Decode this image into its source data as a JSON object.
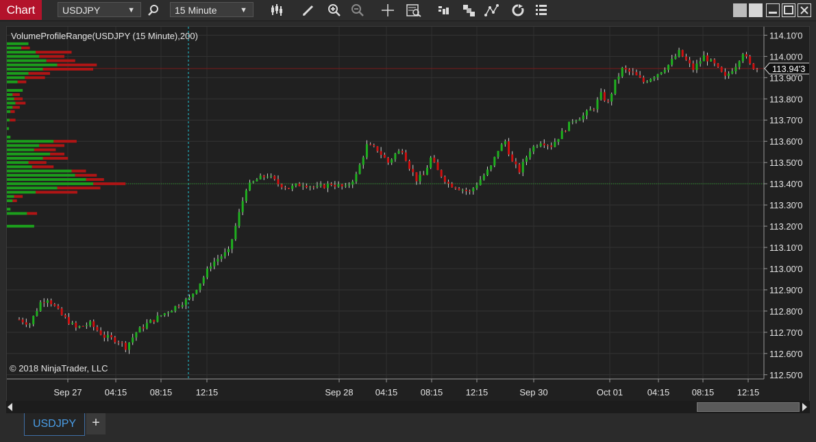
{
  "toolbar": {
    "chart_label": "Chart",
    "instrument": "USDJPY",
    "interval": "15 Minute",
    "icons": [
      "search-icon",
      "bar-type-icon",
      "draw-icon",
      "zoom-in-icon",
      "zoom-out-icon",
      "crosshair-icon",
      "data-box-icon",
      "order-icon",
      "templates-icon",
      "indicators-icon",
      "reload-icon",
      "properties-icon"
    ]
  },
  "chart": {
    "indicator_label": "VolumeProfileRange(USDJPY (15 Minute),200)",
    "copyright": "© 2018 NinjaTrader, LLC",
    "current_price_label": "113.94'3",
    "colors": {
      "up": "#1fb11f",
      "down": "#d01010",
      "background": "#202020"
    }
  },
  "chart_data": {
    "type": "candlestick",
    "symbol": "USDJPY",
    "interval": "15 Minute",
    "y_ticks": [
      "114.10'0",
      "114.00'0",
      "113.90'0",
      "113.80'0",
      "113.70'0",
      "113.60'0",
      "113.50'0",
      "113.40'0",
      "113.30'0",
      "113.20'0",
      "113.10'0",
      "113.00'0",
      "112.90'0",
      "112.80'0",
      "112.70'0",
      "112.60'0",
      "112.50'0"
    ],
    "ylim": [
      112.48,
      114.14
    ],
    "x_ticks": [
      "Sep 27",
      "04:15",
      "08:15",
      "12:15",
      "Sep 28",
      "04:15",
      "08:15",
      "12:15",
      "Sep 30",
      "Oct 01",
      "04:15",
      "08:15",
      "12:15"
    ],
    "last_price": 113.943,
    "poc_price": 113.4,
    "price_path": [
      [
        0,
        112.76
      ],
      [
        3,
        112.74
      ],
      [
        6,
        112.84
      ],
      [
        8,
        112.86
      ],
      [
        12,
        112.78
      ],
      [
        16,
        112.72
      ],
      [
        20,
        112.74
      ],
      [
        24,
        112.68
      ],
      [
        28,
        112.66
      ],
      [
        30,
        112.63
      ],
      [
        33,
        112.7
      ],
      [
        36,
        112.74
      ],
      [
        40,
        112.78
      ],
      [
        44,
        112.82
      ],
      [
        48,
        112.86
      ],
      [
        52,
        112.96
      ],
      [
        54,
        113.02
      ],
      [
        57,
        113.06
      ],
      [
        59,
        113.08
      ],
      [
        61,
        113.2
      ],
      [
        64,
        113.38
      ],
      [
        67,
        113.42
      ],
      [
        70,
        113.44
      ],
      [
        73,
        113.4
      ],
      [
        76,
        113.38
      ],
      [
        80,
        113.4
      ],
      [
        84,
        113.38
      ],
      [
        88,
        113.4
      ],
      [
        92,
        113.38
      ],
      [
        95,
        113.44
      ],
      [
        98,
        113.58
      ],
      [
        101,
        113.56
      ],
      [
        104,
        113.5
      ],
      [
        106,
        113.54
      ],
      [
        108,
        113.56
      ],
      [
        110,
        113.48
      ],
      [
        112,
        113.42
      ],
      [
        114,
        113.44
      ],
      [
        116,
        113.52
      ],
      [
        118,
        113.46
      ],
      [
        121,
        113.4
      ],
      [
        124,
        113.38
      ],
      [
        127,
        113.36
      ],
      [
        130,
        113.42
      ],
      [
        133,
        113.48
      ],
      [
        135,
        113.56
      ],
      [
        137,
        113.6
      ],
      [
        139,
        113.5
      ],
      [
        141,
        113.46
      ],
      [
        144,
        113.56
      ],
      [
        147,
        113.6
      ],
      [
        150,
        113.58
      ],
      [
        153,
        113.64
      ],
      [
        156,
        113.7
      ],
      [
        159,
        113.72
      ],
      [
        162,
        113.76
      ],
      [
        164,
        113.82
      ],
      [
        166,
        113.78
      ],
      [
        168,
        113.88
      ],
      [
        170,
        113.94
      ],
      [
        173,
        113.92
      ],
      [
        176,
        113.88
      ],
      [
        180,
        113.92
      ],
      [
        183,
        113.96
      ],
      [
        186,
        114.02
      ],
      [
        188,
        113.98
      ],
      [
        190,
        113.94
      ],
      [
        193,
        114.0
      ],
      [
        196,
        113.96
      ],
      [
        199,
        113.9
      ],
      [
        202,
        113.96
      ],
      [
        204,
        114.02
      ],
      [
        206,
        113.96
      ],
      [
        208,
        113.94
      ]
    ],
    "volume_profile": {
      "levels": [
        114.06,
        114.04,
        114.02,
        114.0,
        113.98,
        113.96,
        113.94,
        113.92,
        113.9,
        113.88,
        113.84,
        113.82,
        113.8,
        113.78,
        113.76,
        113.74,
        113.7,
        113.66,
        113.62,
        113.6,
        113.58,
        113.56,
        113.54,
        113.52,
        113.5,
        113.48,
        113.46,
        113.44,
        113.42,
        113.4,
        113.38,
        113.36,
        113.34,
        113.32,
        113.28,
        113.26,
        113.2
      ],
      "up": [
        30,
        20,
        40,
        45,
        55,
        70,
        50,
        30,
        25,
        15,
        22,
        8,
        10,
        12,
        8,
        5,
        4,
        3,
        5,
        65,
        45,
        38,
        60,
        50,
        30,
        35,
        90,
        95,
        110,
        120,
        70,
        40,
        10,
        8,
        5,
        28,
        38
      ],
      "down": [
        0,
        12,
        50,
        35,
        40,
        55,
        70,
        30,
        28,
        12,
        0,
        10,
        12,
        14,
        10,
        6,
        8,
        0,
        0,
        32,
        35,
        30,
        20,
        35,
        25,
        30,
        20,
        30,
        25,
        45,
        60,
        58,
        12,
        6,
        0,
        14,
        0
      ]
    }
  },
  "bottom": {
    "tab_label": "USDJPY",
    "add_label": "+"
  }
}
